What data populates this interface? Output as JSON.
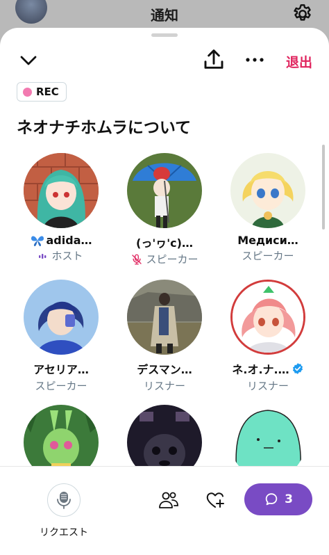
{
  "background": {
    "title": "通知",
    "settings_icon": "gear-icon"
  },
  "sheet": {
    "leave_label": "退出",
    "rec_label": "REC",
    "title": "ネオナチホムラについて"
  },
  "participants": [
    {
      "name": "adida…",
      "prefix_icon": "butterfly-emoji",
      "role": "ホスト",
      "role_icon": "audio-wave-icon"
    },
    {
      "name": "(っ'ヮ'c)…",
      "role": "スピーカー",
      "role_icon": "mic-muted-icon"
    },
    {
      "name": "Медиси…",
      "role": "スピーカー"
    },
    {
      "name": "アセリア…",
      "role": "スピーカー"
    },
    {
      "name": "デスマン…",
      "role": "リスナー"
    },
    {
      "name": "ネ.オ.ナ.…",
      "role": "リスナー",
      "verified": true
    },
    {
      "name": "",
      "role": ""
    },
    {
      "name": "",
      "role": ""
    },
    {
      "name": "",
      "role": ""
    }
  ],
  "bottom": {
    "request_label": "リクエスト",
    "chat_count": "3"
  },
  "colors": {
    "accent_red": "#e0245e",
    "chat_purple": "#794bc4",
    "rec_dot": "#f27ab0",
    "verified_blue": "#1d9bf0",
    "muted_pink": "#e0245e"
  }
}
